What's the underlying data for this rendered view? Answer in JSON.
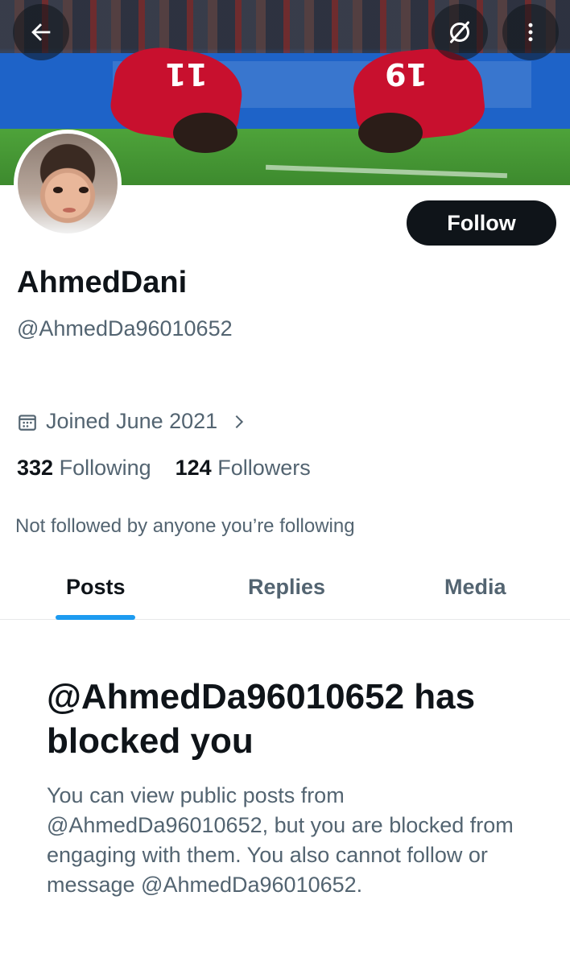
{
  "header": {
    "back_icon": "arrow-left-icon",
    "grok_icon": "grok-icon",
    "more_icon": "more-vertical-icon"
  },
  "banner": {
    "jersey_left": "11",
    "jersey_right": "19"
  },
  "profile": {
    "display_name": "AhmedDani",
    "handle": "@AhmedDa96010652",
    "follow_label": "Follow",
    "joined": "Joined June 2021",
    "following_count": "332",
    "following_label": "Following",
    "followers_count": "124",
    "followers_label": "Followers",
    "not_followed": "Not followed by anyone you’re following"
  },
  "tabs": [
    {
      "label": "Posts",
      "active": true
    },
    {
      "label": "Replies",
      "active": false
    },
    {
      "label": "Media",
      "active": false
    }
  ],
  "blocked": {
    "title": "@AhmedDa96010652 has blocked you",
    "description": "You can view public posts from @AhmedDa96010652, but you are blocked from engaging with them. You also cannot follow or message @AhmedDa96010652."
  },
  "colors": {
    "accent": "#1d9bf0",
    "text_primary": "#0f1419",
    "text_secondary": "#536471"
  }
}
